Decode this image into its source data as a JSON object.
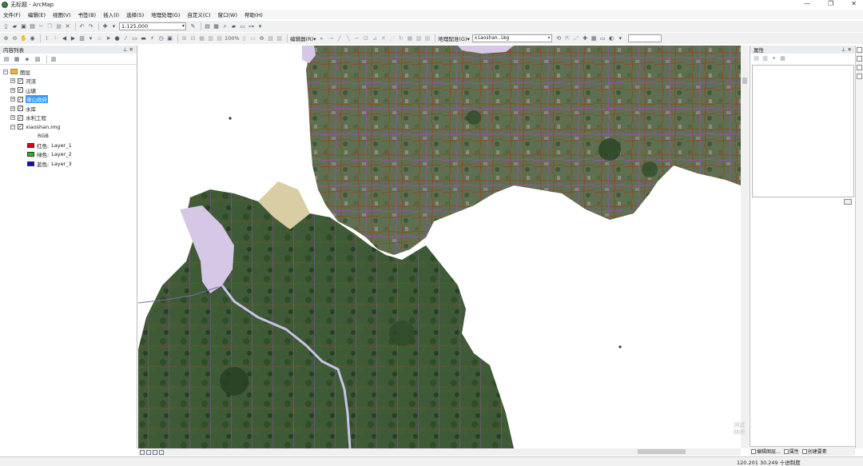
{
  "window": {
    "title": "无标题 - ArcMap",
    "controls": [
      "—",
      "❐",
      "✕"
    ]
  },
  "menu": [
    "文件(F)",
    "编辑(E)",
    "视图(V)",
    "书签(B)",
    "插入(I)",
    "选择(S)",
    "地理处理(G)",
    "自定义(C)",
    "窗口(W)",
    "帮助(H)"
  ],
  "toolbar": {
    "scale": "1:125,000",
    "zoom": "100%",
    "editor_label": "编辑器(R)▾",
    "georef_label": "地理配准(G)▾",
    "georef_layer": "xiaoshan.img"
  },
  "toc": {
    "title": "内容列表",
    "root": "图层",
    "layers": [
      {
        "name": "河流",
        "checked": true,
        "selected": false
      },
      {
        "name": "山塘",
        "checked": true,
        "selected": false
      },
      {
        "name": "萧山政府",
        "checked": true,
        "selected": true
      },
      {
        "name": "水库",
        "checked": true,
        "selected": false
      },
      {
        "name": "水利工程",
        "checked": true,
        "selected": false
      },
      {
        "name": "xiaoshan.img",
        "checked": true,
        "selected": false
      }
    ],
    "raster_label": "RGB",
    "bands": [
      {
        "label": "红色:",
        "layer": "Layer_1",
        "color": "#e0001b"
      },
      {
        "label": "绿色:",
        "layer": "Layer_2",
        "color": "#18c418"
      },
      {
        "label": "蓝色:",
        "layer": "Layer_3",
        "color": "#1010c8"
      }
    ]
  },
  "properties": {
    "title": "属性",
    "tabs": [
      "编辑图层...",
      "属性",
      "创建要素"
    ]
  },
  "watermark": [
    "测试",
    "林吧"
  ],
  "status": {
    "coords": "120.201  30.249 十进制度"
  },
  "colors": {
    "selection": "#3399ff",
    "road": "#8a4a2a",
    "river": "#9a4fb0"
  }
}
